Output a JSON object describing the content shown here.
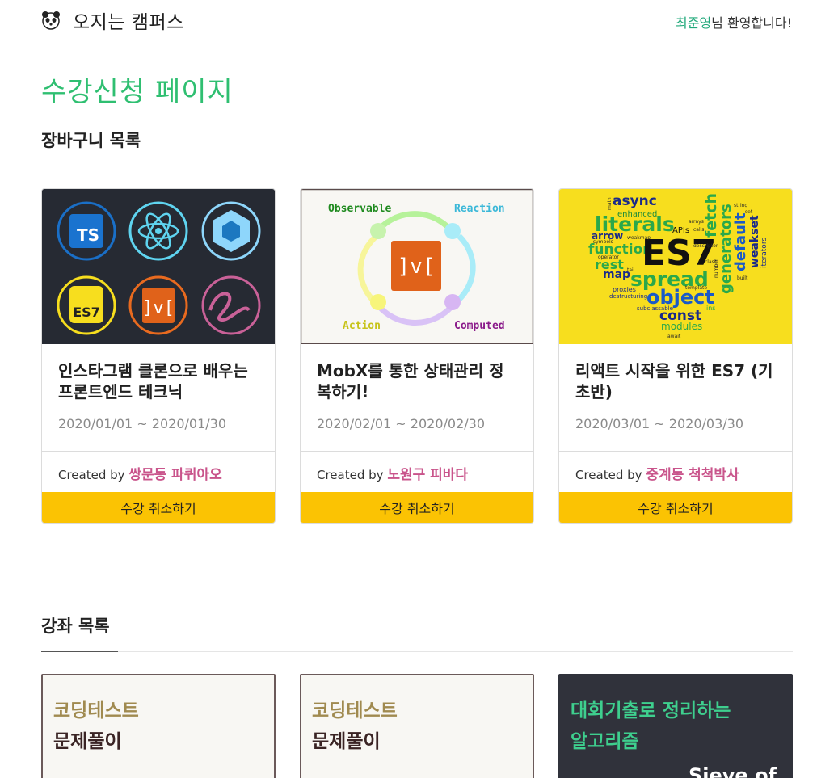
{
  "header": {
    "brand": "오지는 캠퍼스",
    "user_name": "최준영",
    "welcome_suffix": "님 환영합니다!"
  },
  "page_title": "수강신청 페이지",
  "cart": {
    "title": "장바구니 목록",
    "created_by_label": "Created by",
    "cancel_label": "수강 취소하기",
    "courses": [
      {
        "title": "인스타그램 클론으로 배우는 프론트엔드 테크닉",
        "date": "2020/01/01 ~ 2020/01/30",
        "author": "쌍문동 파퀴아오",
        "thumb_icons": [
          "TS",
          "ES7",
          "]v["
        ]
      },
      {
        "title": "MobX를 통한 상태관리 정복하기!",
        "date": "2020/02/01 ~ 2020/02/30",
        "author": "노원구 피바다",
        "thumb_labels": {
          "tl": "Observable",
          "tr": "Reaction",
          "bl": "Action",
          "br": "Computed",
          "center": "]v["
        }
      },
      {
        "title": "리액트 시작을 위한 ES7 (기초반)",
        "date": "2020/03/01 ~ 2020/03/30",
        "author": "중계동 척척박사",
        "thumb_words": [
          "async",
          "enhanced",
          "literals",
          "arrow",
          "function",
          "rest",
          "map",
          "spread",
          "object",
          "const",
          "modules",
          "ES7",
          "APIs",
          "fetch",
          "generators",
          "default",
          "weakset",
          "iterators",
          "proxies",
          "destructuring",
          "subclassable",
          "ins",
          "symbols",
          "operator",
          "tail",
          "weakmap",
          "math",
          "string",
          "set",
          "template",
          "number",
          "await",
          "built",
          "class",
          "arrays",
          "calls",
          "descriptor"
        ]
      }
    ]
  },
  "lectures": {
    "title": "강좌 목록",
    "items": [
      {
        "line1": "코딩테스트",
        "line2": "문제풀이",
        "line3": ""
      },
      {
        "line1": "코딩테스트",
        "line2": "문제풀이",
        "line3": ""
      },
      {
        "line1": "대회기출로 정리하는",
        "line2": "알고리즘",
        "line3": "Sieve of"
      }
    ]
  },
  "colors": {
    "accent_green": "#2fbf71",
    "author_pink": "#c9548b",
    "button_yellow": "#fbc303",
    "dark_thumb": "#262a33",
    "es7_yellow": "#f7de1e"
  }
}
